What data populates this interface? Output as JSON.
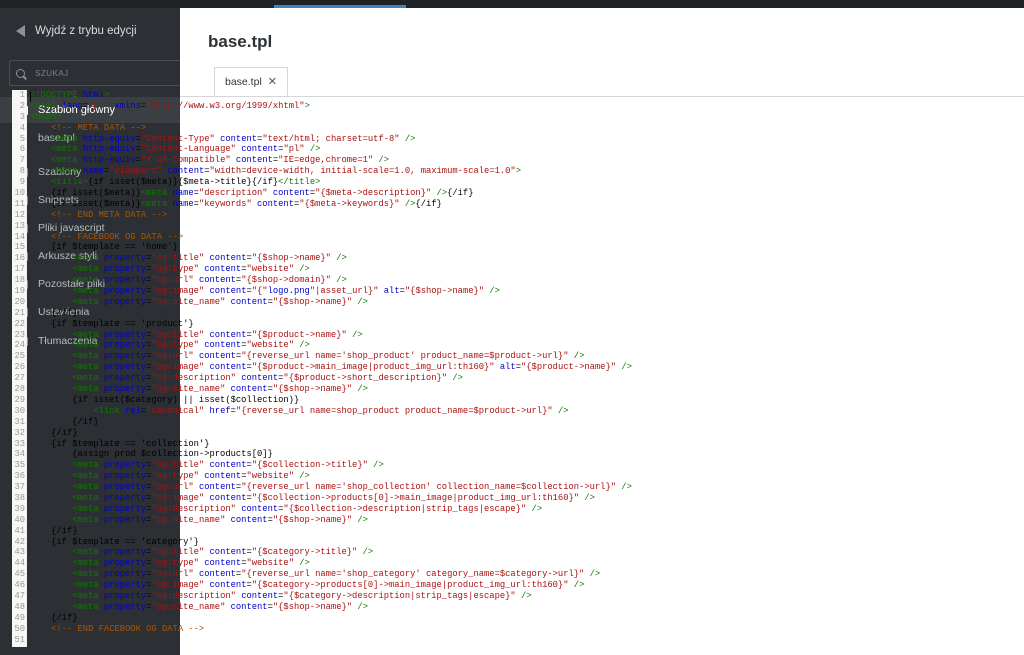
{
  "sidebar": {
    "exit_label": "Wyjdź z trybu edycji",
    "search_placeholder": "SZUKAJ",
    "main_template": "Szablon główny",
    "active_file": "base.tpl",
    "items": [
      "Szablony",
      "Snippets",
      "Pliki javascript",
      "Arkusze styli",
      "Pozostałe pliki",
      "Ustawienia",
      "Tłumaczenia"
    ]
  },
  "editor": {
    "title": "base.tpl",
    "tab_label": "base.tpl",
    "close_glyph": "✕",
    "line_numbers": [
      "1",
      "2",
      "3",
      "4",
      "5",
      "6",
      "7",
      "8",
      "9",
      "10",
      "11",
      "12",
      "13",
      "14",
      "15",
      "16",
      "17",
      "18",
      "19",
      "20",
      "21",
      "22",
      "23",
      "24",
      "25",
      "26",
      "27",
      "28",
      "29",
      "30",
      "31",
      "32",
      "33",
      "34",
      "35",
      "36",
      "37",
      "38",
      "39",
      "40",
      "41",
      "42",
      "43",
      "44",
      "45",
      "46",
      "47",
      "48",
      "49",
      "50",
      "51"
    ],
    "lines": [
      "<!DOCTYPE html>",
      "<html lang=\"pl\" xmlns=\"http://www.w3.org/1999/xhtml\">",
      "<head>",
      "    <!-- META DATA -->",
      "    <meta http-equiv=\"Content-Type\" content=\"text/html; charset=utf-8\" />",
      "    <meta http-equiv=\"Content-Language\" content=\"pl\" />",
      "    <meta http-equiv=\"X-UA-Compatible\" content=\"IE=edge,chrome=1\" />",
      "    <meta name=\"viewport\" content=\"width=device-width, initial-scale=1.0, maximum-scale=1.0\">",
      "    <title>{if isset($meta)}{$meta->title}{/if}</title>",
      "    {if isset($meta)}<meta name=\"description\" content=\"{$meta->description}\" />{/if}",
      "    {if isset($meta)}<meta name=\"keywords\" content=\"{$meta->keywords}\" />{/if}",
      "    <!-- END META DATA -->",
      "",
      "    <!-- FACEBOOK OG DATA -->",
      "    {if $template == 'home'}",
      "        <meta property=\"og:title\" content=\"{$shop->name}\" />",
      "        <meta property=\"og:type\" content=\"website\" />",
      "        <meta property=\"og:url\" content=\"{$shop->domain}\" />",
      "        <meta property=\"og:image\" content=\"{\"logo.png\"|asset_url}\" alt=\"{$shop->name}\" />",
      "        <meta property=\"og:site_name\" content=\"{$shop->name}\" />",
      "    {/if}",
      "    {if $template == 'product'}",
      "        <meta property=\"og:title\" content=\"{$product->name}\" />",
      "        <meta property=\"og:type\" content=\"website\" />",
      "        <meta property=\"og:url\" content=\"{reverse_url name='shop_product' product_name=$product->url}\" />",
      "        <meta property=\"og:image\" content=\"{$product->main_image|product_img_url:th160}\" alt=\"{$product->name}\" />",
      "        <meta property=\"og:description\" content=\"{$product->short_description}\" />",
      "        <meta property=\"og:site_name\" content=\"{$shop->name}\" />",
      "        {if isset($category) || isset($collection)}",
      "            <link rel=\"canonical\" href=\"{reverse_url name=shop_product product_name=$product->url}\" />",
      "        {/if}",
      "    {/if}",
      "    {if $template == 'collection'}",
      "        {assign prod $collection->products[0]}",
      "        <meta property=\"og:title\" content=\"{$collection->title}\" />",
      "        <meta property=\"og:type\" content=\"website\" />",
      "        <meta property=\"og:url\" content=\"{reverse_url name='shop_collection' collection_name=$collection->url}\" />",
      "        <meta property=\"og:image\" content=\"{$collection->products[0]->main_image|product_img_url:th160}\" />",
      "        <meta property=\"og:description\" content=\"{$collection->description|strip_tags|escape}\" />",
      "        <meta property=\"og:site_name\" content=\"{$shop->name}\" />",
      "    {/if}",
      "    {if $template == 'category'}",
      "        <meta property=\"og:title\" content=\"{$category->title}\" />",
      "        <meta property=\"og:type\" content=\"website\" />",
      "        <meta property=\"og:url\" content=\"{reverse_url name='shop_category' category_name=$category->url}\" />",
      "        <meta property=\"og:image\" content=\"{$category->products[0]->main_image|product_img_url:th160}\" />",
      "        <meta property=\"og:description\" content=\"{$category->description|strip_tags|escape}\" />",
      "        <meta property=\"og:site_name\" content=\"{$shop->name}\" />",
      "    {/if}",
      "    <!-- END FACEBOOK OG DATA -->",
      ""
    ]
  },
  "colors": {
    "sidebar_bg": "#2c3034",
    "active_item_bg": "#3a3f44",
    "accent": "#3d86c6",
    "tag": "#117700",
    "attribute": "#0000cc",
    "string": "#aa1111",
    "comment": "#aa5500"
  }
}
